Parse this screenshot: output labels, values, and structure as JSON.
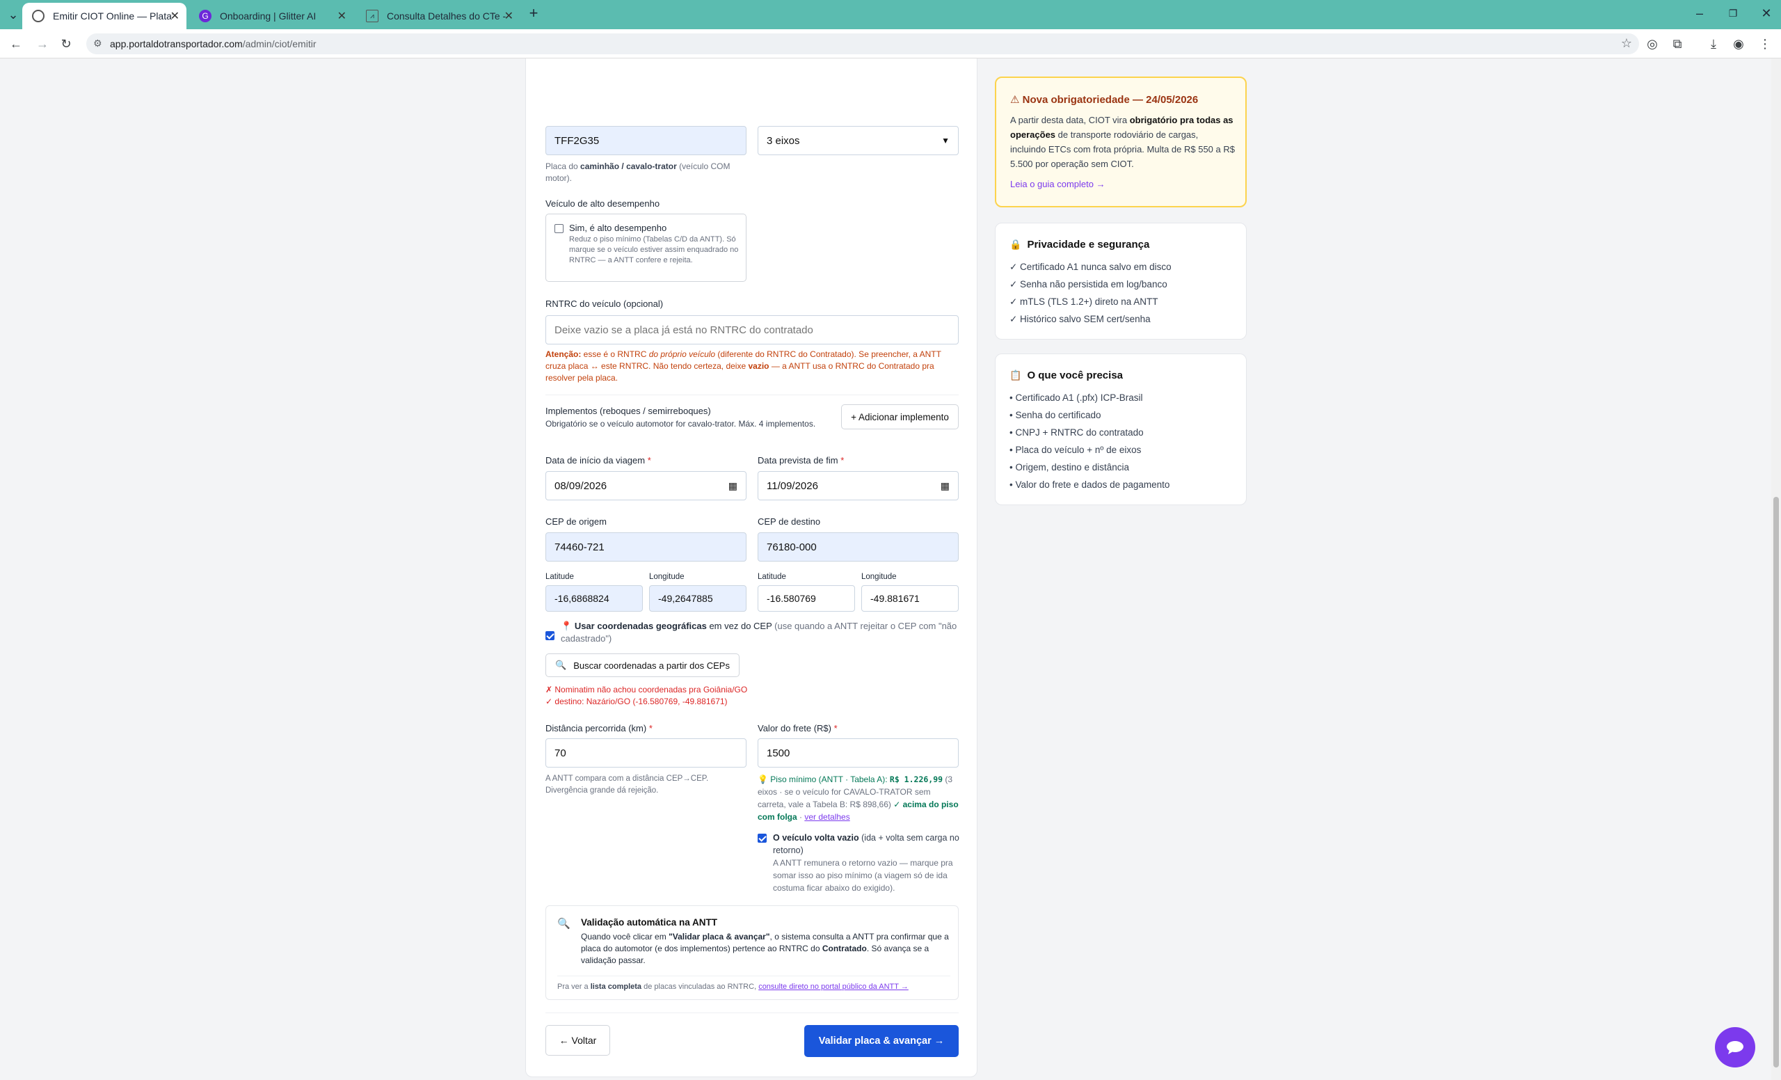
{
  "browser": {
    "tabs": [
      {
        "label": "Emitir CIOT Online — Plataforma",
        "icon": "globe-icon"
      },
      {
        "label": "Onboarding | Glitter AI",
        "icon": "glitter-icon"
      },
      {
        "label": "Consulta Detalhes do CTe - ERP",
        "icon": "chart-icon"
      }
    ],
    "url_host": "app.portaldotransportador.com",
    "url_path": "/admin/ciot/emitir"
  },
  "form": {
    "placa_value": "TFF2G35",
    "placa_help_prefix": "Placa do ",
    "placa_help_bold": "caminhão / cavalo-trator",
    "placa_help_suffix": " (veículo COM motor).",
    "eixos_value": "3 eixos",
    "alto_label": "Veículo de alto desempenho",
    "alto_check": "Sim, é alto desempenho",
    "alto_help": "Reduz o piso mínimo (Tabelas C/D da ANTT). Só marque se o veículo estiver assim enquadrado no RNTRC — a ANTT confere e rejeita.",
    "rntrc_label": "RNTRC do veículo (opcional)",
    "rntrc_placeholder": "Deixe vazio se a placa já está no RNTRC do contratado",
    "rntrc_warn_bold": "Atenção:",
    "rntrc_warn_1": " esse é o RNTRC ",
    "rntrc_warn_italic": "do próprio veículo",
    "rntrc_warn_2": " (diferente do RNTRC do Contratado). Se preencher, a ANTT cruza placa ↔ este RNTRC. Não tendo certeza, deixe ",
    "rntrc_warn_bold2": "vazio",
    "rntrc_warn_3": " — a ANTT usa o RNTRC do Contratado pra resolver pela placa.",
    "impl_title": "Implementos (reboques / semirreboques)",
    "impl_help": "Obrigatório se o veículo automotor for cavalo-trator. Máx. 4 implementos.",
    "impl_button": "+ Adicionar implemento",
    "inicio_label": "Data de início da viagem",
    "inicio_value": "08/09/2026",
    "fim_label": "Data prevista de fim",
    "fim_value": "11/09/2026",
    "cep_origem_label": "CEP de origem",
    "cep_origem_value": "74460-721",
    "cep_destino_label": "CEP de destino",
    "cep_destino_value": "76180-000",
    "lat_label": "Latitude",
    "lon_label": "Longitude",
    "orig_lat": "-16,6868824",
    "orig_lon": "-49,2647885",
    "dest_lat": "-16.580769",
    "dest_lon": "-49.881671",
    "coord_bold": "Usar coordenadas geográficas",
    "coord_text": " em vez do CEP ",
    "coord_gray": "(use quando a ANTT rejeitar o CEP com \"não cadastrado\")",
    "buscar_button": "Buscar coordenadas a partir dos CEPs",
    "geo_error": "✗ Nominatim não achou coordenadas pra Goiânia/GO",
    "geo_ok": "✓ destino: Nazário/GO (-16.580769, -49.881671)",
    "dist_label": "Distância percorrida (km)",
    "dist_value": "70",
    "dist_help": "A ANTT compara com a distância CEP→CEP. Divergência grande dá rejeição.",
    "frete_label": "Valor do frete (R$)",
    "frete_value": "1500",
    "piso_1": "Piso mínimo (ANTT · Tabela A): ",
    "piso_value": "R$ 1.226,99",
    "piso_2": " (3 eixos · se o veículo for CAVALO-TRATOR sem carreta, vale a Tabela B: R$ 898,66) ",
    "piso_ok": "✓ acima do piso com folga",
    "piso_sep": " · ",
    "piso_link": "ver detalhes",
    "volta_bold": "O veículo volta vazio",
    "volta_text": " (ida + volta sem carga no retorno)",
    "volta_help": "A ANTT remunera o retorno vazio — marque pra somar isso ao piso mínimo (a viagem só de ida costuma ficar abaixo do exigido).",
    "valid_title": "Validação automática na ANTT",
    "valid_1": "Quando você clicar em ",
    "valid_bold1": "\"Validar placa & avançar\"",
    "valid_2": ", o sistema consulta a ANTT pra confirmar que a placa do automotor (e dos implementos) pertence ao RNTRC do ",
    "valid_bold2": "Contratado",
    "valid_3": ". Só avança se a validação passar.",
    "valid_foot_1": "Pra ver a ",
    "valid_foot_bold": "lista completa",
    "valid_foot_2": " de placas vinculadas ao RNTRC, ",
    "valid_foot_link": "consulte direto no portal público da ANTT →",
    "back_button": "← Voltar",
    "next_button": "Validar placa & avançar →"
  },
  "sidebar": {
    "notice_title": "⚠ Nova obrigatoriedade — 24/05/2026",
    "notice_1": "A partir desta data, CIOT vira ",
    "notice_bold": "obrigatório pra todas as operações",
    "notice_2": " de transporte rodoviário de cargas, incluindo ETCs com frota própria. Multa de R$ 550 a R$ 5.500 por operação sem CIOT.",
    "notice_link": "Leia o guia completo →",
    "privacy_title": "Privacidade e segurança",
    "privacy_items": [
      "✓ Certificado A1 nunca salvo em disco",
      "✓ Senha não persistida em log/banco",
      "✓ mTLS (TLS 1.2+) direto na ANTT",
      "✓ Histórico salvo SEM cert/senha"
    ],
    "need_title": "O que você precisa",
    "need_items": [
      "• Certificado A1 (.pfx) ICP-Brasil",
      "• Senha do certificado",
      "• CNPJ + RNTRC do contratado",
      "• Placa do veículo + nº de eixos",
      "• Origem, destino e distância",
      "• Valor do frete e dados de pagamento"
    ]
  },
  "colors": {
    "accent": "#1a56db",
    "purple": "#7c3aed",
    "tabbar": "#5bbcb0",
    "warning_bg": "#fffbeb",
    "warning_border": "#fcd34d"
  }
}
